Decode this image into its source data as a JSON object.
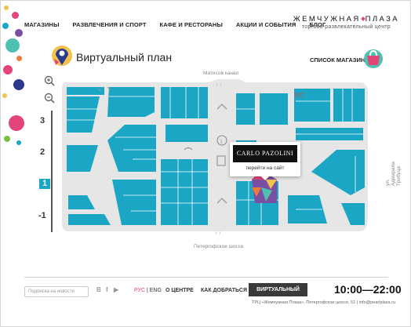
{
  "nav": {
    "items": [
      "МАГАЗИНЫ",
      "РАЗВЛЕЧЕНИЯ И СПОРТ",
      "КАФЕ И РЕСТОРАНЫ",
      "АКЦИИ И СОБЫТИЯ",
      "БЛОГ"
    ]
  },
  "brand": {
    "title_left": "ЖЕМЧУЖНАЯ",
    "title_right": "ПЛАЗА",
    "subtitle": "торгово-развлекательный центр"
  },
  "page": {
    "title": "Виртуальный план",
    "stores_link": "СПИСОК МАГАЗИНОВ"
  },
  "floors": [
    "3",
    "2",
    "1",
    "-1"
  ],
  "active_floor": "1",
  "map": {
    "street_top": "Матисов канал",
    "street_bottom": "Петергофское шоссе",
    "street_right": "ул. Адмирала Трибуца",
    "wc_label": "WC",
    "wifi_label": "Wi-Fi"
  },
  "popup": {
    "logo": "CARLO PAZOLINI",
    "link": "перейти на сайт"
  },
  "footer": {
    "news_placeholder": "Подписка на новости",
    "lang_ru": "РУС",
    "lang_sep": "|",
    "lang_en": "ENG",
    "about": "О ЦЕНТРЕ",
    "route": "КАК ДОБРАТЬСЯ",
    "virtual_plan": "ВИРТУАЛЬНЫЙ ПЛАН",
    "hours": "10:00—22:00",
    "address": "ТРЦ «Жемчужная Плаза», Петергофское шоссе, 51   |   info@pearlplaza.ru"
  },
  "colors": {
    "store": "#1aa6c4",
    "corridor": "#e3e3e3",
    "accent": "#e3457a"
  }
}
